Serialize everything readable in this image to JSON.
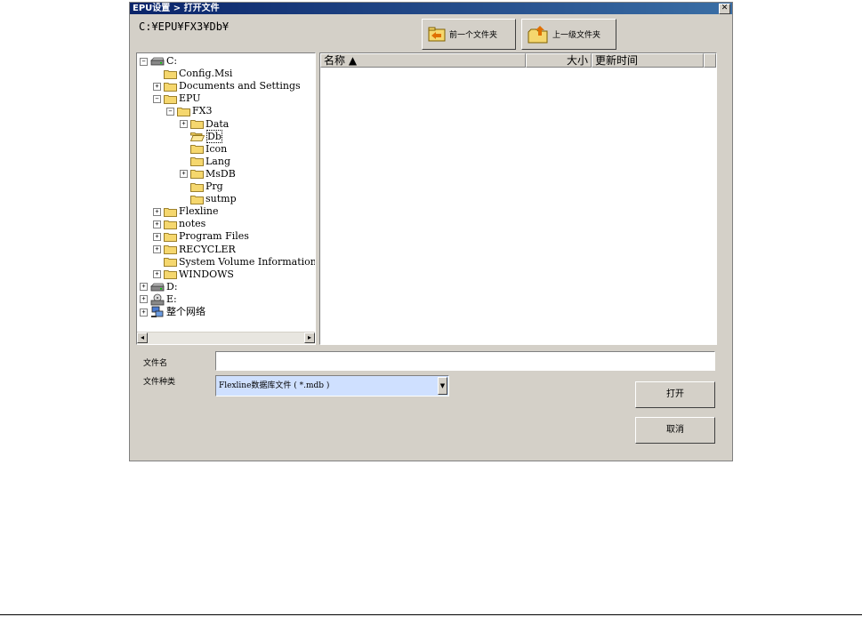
{
  "window": {
    "title": "EPU设置 > 打开文件",
    "close_glyph": "✕"
  },
  "path": "C:¥EPU¥FX3¥Db¥",
  "nav": {
    "back_label": "前一个文件夹",
    "up_label": "上一级文件夹",
    "back_icon": "folder-back-icon",
    "up_icon": "folder-up-icon"
  },
  "tree": [
    {
      "label": "C:",
      "expander": "−",
      "icon": "drive-icon"
    },
    {
      "label": "Config.Msi",
      "expander": "",
      "icon": "folder-icon"
    },
    {
      "label": "Documents and Settings",
      "expander": "+",
      "icon": "folder-icon"
    },
    {
      "label": "EPU",
      "expander": "−",
      "icon": "folder-icon"
    },
    {
      "label": "FX3",
      "expander": "−",
      "icon": "folder-icon"
    },
    {
      "label": "Data",
      "expander": "+",
      "icon": "folder-icon"
    },
    {
      "label": "Db",
      "expander": "",
      "icon": "folder-open-icon"
    },
    {
      "label": "Icon",
      "expander": "",
      "icon": "folder-icon"
    },
    {
      "label": "Lang",
      "expander": "",
      "icon": "folder-icon"
    },
    {
      "label": "MsDB",
      "expander": "+",
      "icon": "folder-icon"
    },
    {
      "label": "Prg",
      "expander": "",
      "icon": "folder-icon"
    },
    {
      "label": "sutmp",
      "expander": "",
      "icon": "folder-icon"
    },
    {
      "label": "Flexline",
      "expander": "+",
      "icon": "folder-icon"
    },
    {
      "label": "notes",
      "expander": "+",
      "icon": "folder-icon"
    },
    {
      "label": "Program Files",
      "expander": "+",
      "icon": "folder-icon"
    },
    {
      "label": "RECYCLER",
      "expander": "+",
      "icon": "folder-icon"
    },
    {
      "label": "System Volume Information",
      "expander": "",
      "icon": "folder-icon"
    },
    {
      "label": "WINDOWS",
      "expander": "+",
      "icon": "folder-icon"
    },
    {
      "label": "D:",
      "expander": "+",
      "icon": "drive-icon"
    },
    {
      "label": "E:",
      "expander": "+",
      "icon": "cd-drive-icon"
    },
    {
      "label": "整个网络",
      "expander": "+",
      "icon": "network-icon"
    }
  ],
  "list": {
    "columns": [
      "名称 ▲",
      "大小",
      "更新时间"
    ]
  },
  "form": {
    "filename_label": "文件名",
    "filename_value": "",
    "filetype_label": "文件种类",
    "filetype_value": "Flexline数据库文件 ( *.mdb )"
  },
  "buttons": {
    "open": "打开",
    "cancel": "取消"
  },
  "colors": {
    "titlebar_start": "#0a246a",
    "titlebar_end": "#3a6ea5",
    "dialog_bg": "#d4d0c8",
    "folder": "#f5d76e",
    "combo_highlight": "#cfe0ff"
  }
}
